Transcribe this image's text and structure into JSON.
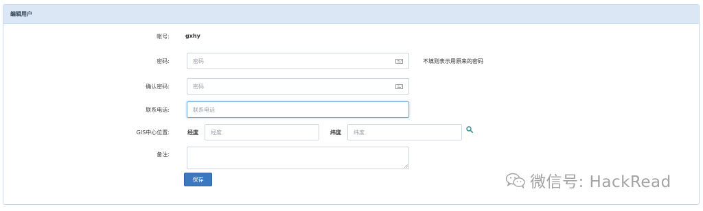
{
  "panel": {
    "title": "编辑用户"
  },
  "form": {
    "account": {
      "label": "帐号:",
      "value": "gxhy"
    },
    "password": {
      "label": "密码:",
      "placeholder": "密码",
      "hint": "不填则表示用原来的密码",
      "icon": "keyboard-icon"
    },
    "confirm_password": {
      "label": "确认密码:",
      "placeholder": "密码",
      "icon": "keyboard-icon"
    },
    "phone": {
      "label": "联系电话:",
      "placeholder": "联系电话"
    },
    "gis": {
      "label": "GIS中心位置:",
      "longitude_label": "经度",
      "longitude_placeholder": "经度",
      "latitude_label": "纬度",
      "latitude_placeholder": "纬度",
      "search_icon": "search-icon"
    },
    "remark": {
      "label": "备注:",
      "value": ""
    },
    "save_label": "保存"
  },
  "watermark": {
    "text": "微信号: HackRead",
    "icon": "wechat-icon"
  },
  "colors": {
    "header_bg": "#dbe7f4",
    "primary_button": "#3a78c0",
    "search_icon": "#2f8a8a",
    "focus_border": "#76aee0"
  }
}
